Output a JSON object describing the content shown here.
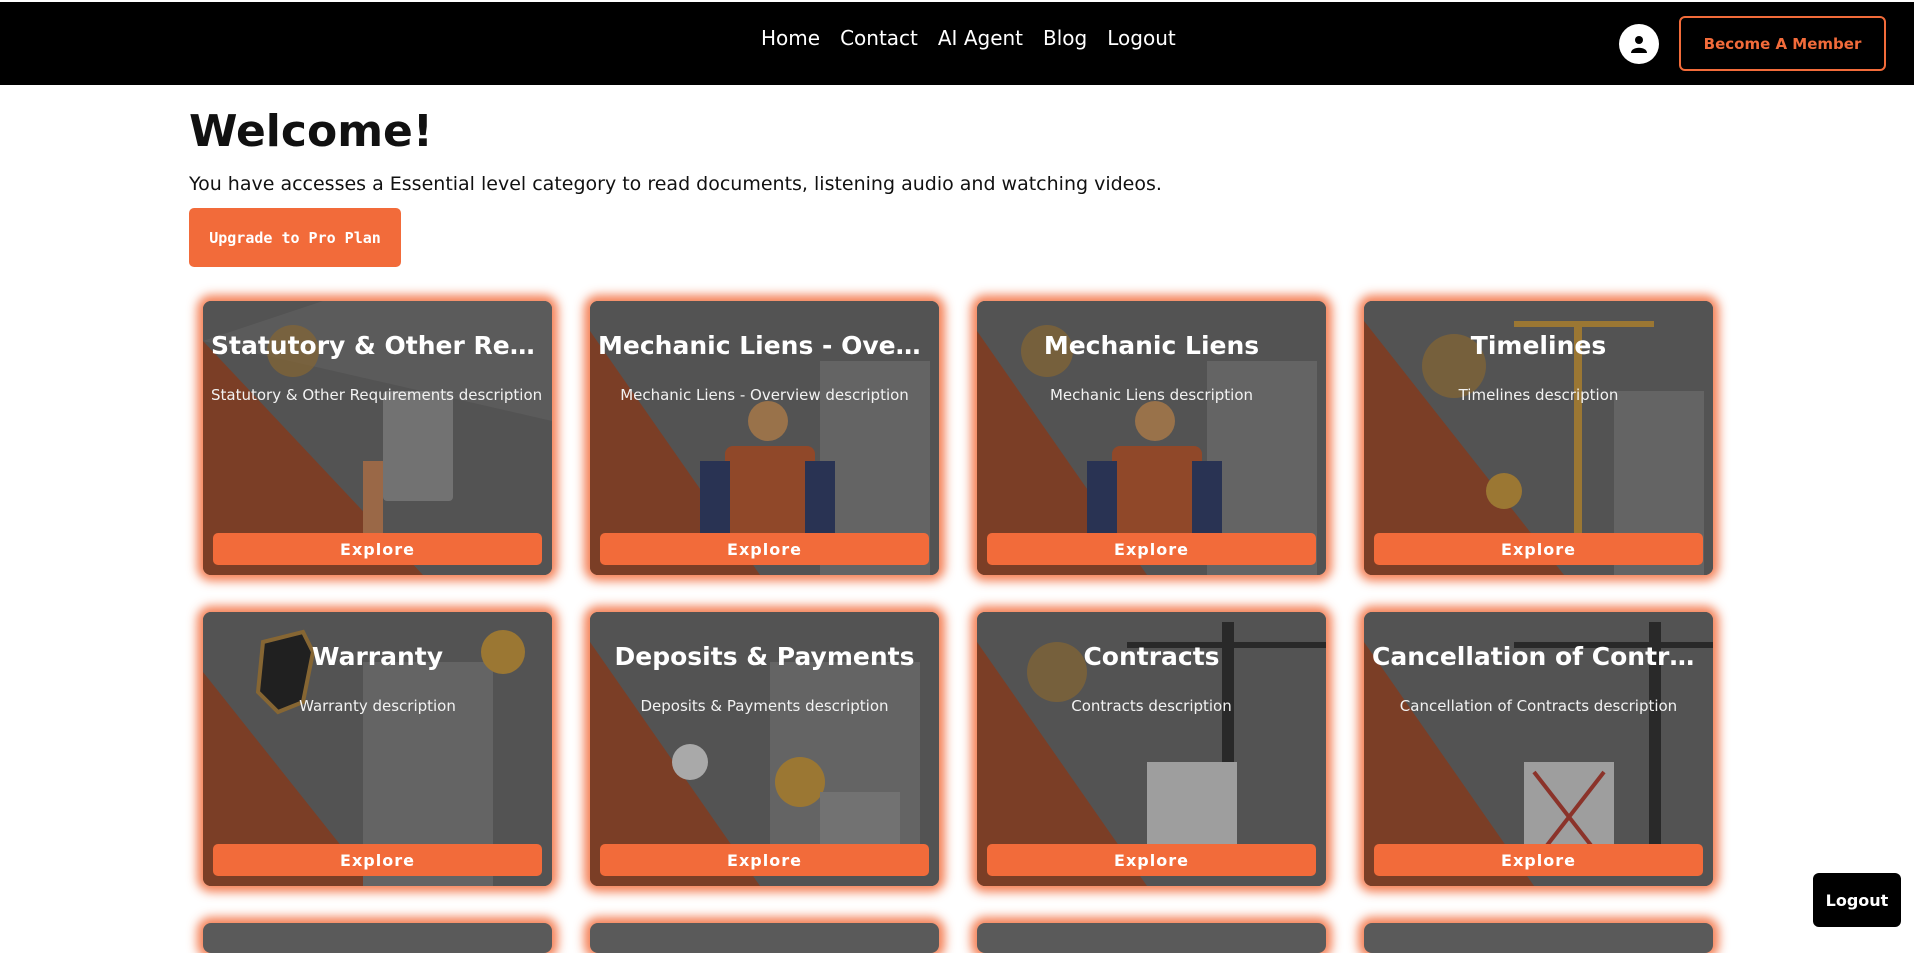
{
  "nav": {
    "links": [
      "Home",
      "Contact",
      "AI Agent",
      "Blog",
      "Logout"
    ],
    "become_member": "Become A Member",
    "user_icon": "user-icon"
  },
  "hero": {
    "title": "Welcome!",
    "subtitle": "You have accesses a Essential level category to read documents, listening audio and watching videos.",
    "upgrade": "Upgrade to Pro Plan"
  },
  "cards": [
    {
      "title": "Statutory & Other Requir...",
      "desc": "Statutory & Other Requirements description",
      "button": "Explore"
    },
    {
      "title": "Mechanic Liens - Overvie...",
      "desc": "Mechanic Liens - Overview description",
      "button": "Explore"
    },
    {
      "title": "Mechanic Liens",
      "desc": "Mechanic Liens description",
      "button": "Explore"
    },
    {
      "title": "Timelines",
      "desc": "Timelines description",
      "button": "Explore"
    },
    {
      "title": "Warranty",
      "desc": "Warranty description",
      "button": "Explore"
    },
    {
      "title": "Deposits & Payments",
      "desc": "Deposits & Payments description",
      "button": "Explore"
    },
    {
      "title": "Contracts",
      "desc": "Contracts description",
      "button": "Explore"
    },
    {
      "title": "Cancellation of Contracts",
      "desc": "Cancellation of Contracts description",
      "button": "Explore"
    }
  ],
  "floating_logout": "Logout",
  "colors": {
    "accent": "#f26b3a",
    "nav_bg": "#000000",
    "card_orange": "#c4552a"
  }
}
